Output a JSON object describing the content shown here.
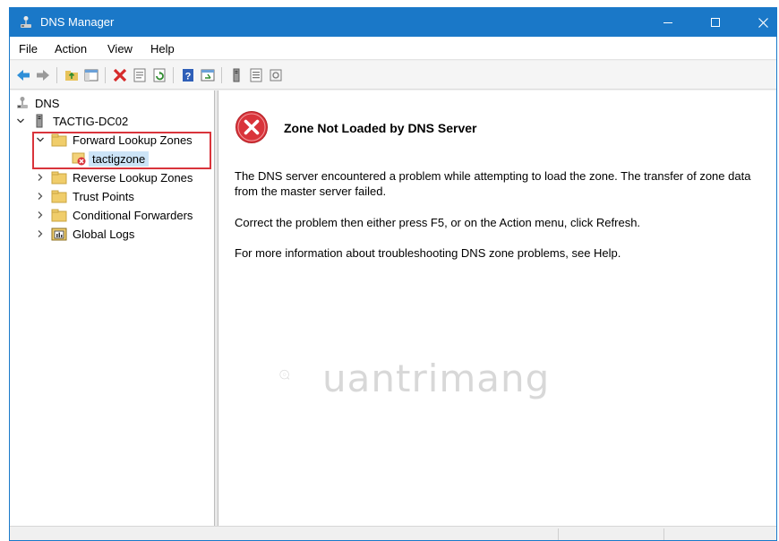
{
  "window": {
    "title": "DNS Manager",
    "accent": "#1a78c8"
  },
  "menu": {
    "items": [
      {
        "label": "File"
      },
      {
        "label": "Action"
      },
      {
        "label": "View"
      },
      {
        "label": "Help"
      }
    ]
  },
  "toolbar": {
    "icons": [
      "back-arrow-icon",
      "forward-arrow-icon",
      "up-folder-icon",
      "show-hide-tree-icon",
      "delete-icon",
      "properties-icon",
      "refresh-icon",
      "help-icon",
      "export-list-icon",
      "server-icon",
      "list-view-icon",
      "detail-view-icon"
    ]
  },
  "tree": {
    "root": "DNS",
    "server": "TACTIG-DC02",
    "forward_zones": "Forward Lookup Zones",
    "zone": "tactigzone",
    "reverse_zones": "Reverse Lookup Zones",
    "trust_points": "Trust Points",
    "conditional_forwarders": "Conditional Forwarders",
    "global_logs": "Global Logs"
  },
  "content": {
    "title": "Zone Not Loaded by DNS Server",
    "para1": "The DNS server encountered a problem while attempting to load the zone. The transfer of zone data from the master server failed.",
    "para2": "Correct the problem then either press F5, or on the Action menu, click Refresh.",
    "para3": "For more information about troubleshooting DNS zone problems, see Help."
  },
  "watermark": {
    "text": "uantrimang"
  },
  "colors": {
    "error_red": "#d9343b",
    "highlight_border": "#d9343b",
    "selection": "#cce4f7"
  }
}
